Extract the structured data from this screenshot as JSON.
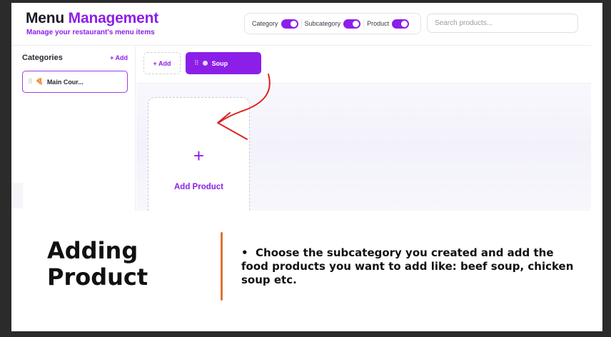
{
  "header": {
    "title_part1": "Menu",
    "title_part2": "Management",
    "subtitle": "Manage your restaurant's menu items"
  },
  "toggles": [
    {
      "label": "Category",
      "on": true
    },
    {
      "label": "Subcategory",
      "on": true
    },
    {
      "label": "Product",
      "on": true
    }
  ],
  "search": {
    "placeholder": "Search products..."
  },
  "sidebar": {
    "heading": "Categories",
    "add_label": "+ Add",
    "items": [
      {
        "label": "Main Cour...",
        "selected": true
      }
    ]
  },
  "subcategories": {
    "add_label": "+ Add",
    "items": [
      {
        "label": "Soup",
        "active": true
      }
    ]
  },
  "product_card": {
    "plus": "+",
    "label": "Add Product"
  },
  "caption": {
    "title": "Adding Product",
    "bullet": "Choose the subcategory you created and add the food products you want to add like: beef soup, chicken soup etc."
  },
  "colors": {
    "accent": "#8b1fe8",
    "annotation_arrow": "#d9231f",
    "divider": "#e07434"
  }
}
